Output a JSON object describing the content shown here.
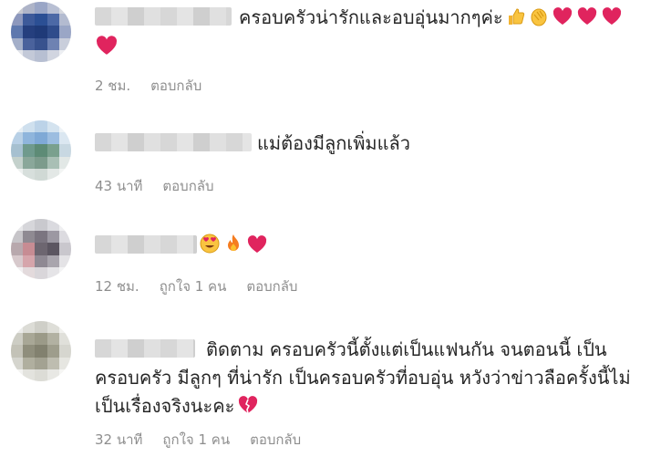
{
  "comments": [
    {
      "line1": "ครอบครัวน่ารักและอบอุ่นมากๆค่ะ",
      "time": "2 ชม.",
      "reply_label": "ตอบกลับ",
      "emojis_line1": [
        "thumbs-up",
        "clapping-hands",
        "heart",
        "heart",
        "heart"
      ],
      "emojis_line2": [
        "heart"
      ]
    },
    {
      "line1": "แม่ต้องมีลูกเพิ่มแล้ว",
      "time": "43 นาที",
      "reply_label": "ตอบกลับ"
    },
    {
      "emojis": [
        "heart-eyes",
        "fire",
        "heart"
      ],
      "time": "12 ชม.",
      "likes": "ถูกใจ 1 คน",
      "reply_label": "ตอบกลับ"
    },
    {
      "line1": "ติดตาม ครอบครัวนี้ตั้งแต่เป็นแฟนกัน จนตอนนี้ เป็น",
      "line2": "ครอบครัว มีลูกๆ ที่น่ารัก เป็นครอบครัวที่อบอุ่น หวังว่าข่าวลือครั้งนี้ไม่",
      "line3": "เป็นเรื่องจริงนะคะ",
      "time": "32 นาที",
      "likes": "ถูกใจ 1 คน",
      "reply_label": "ตอบกลับ",
      "emojis_line3": [
        "broken-heart"
      ]
    }
  ],
  "colors": {
    "text": "#262626",
    "meta": "#8e8e8e",
    "heart": "#e0245e"
  }
}
